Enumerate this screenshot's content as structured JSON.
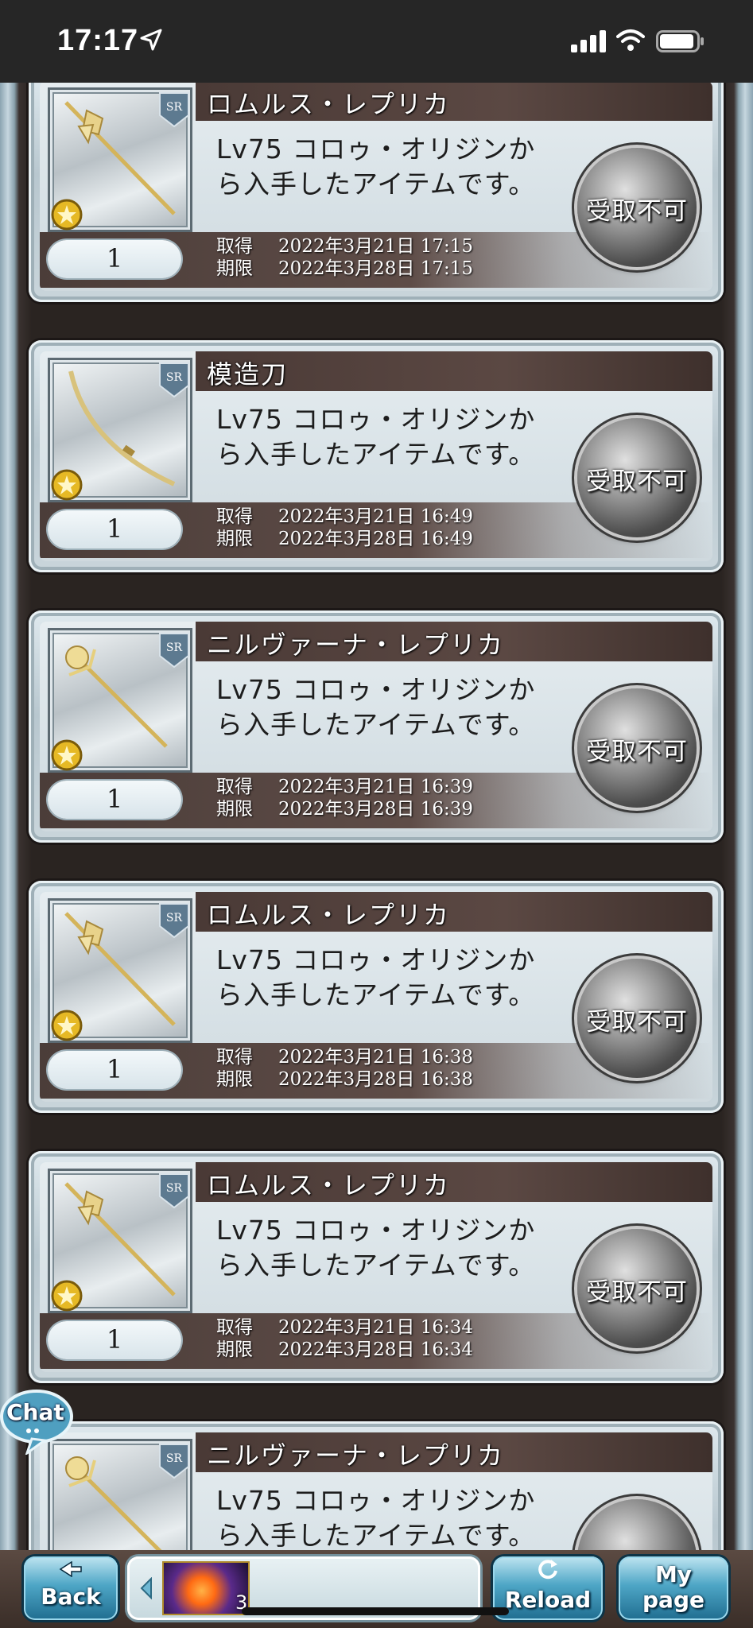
{
  "status_bar": {
    "time": "17:17"
  },
  "items": [
    {
      "name": "ロムルス・レプリカ",
      "rarity": "SR",
      "description": "Lv75 コロゥ・オリジンから入手したアイテムです。",
      "desc_line1": "Lv75 コロゥ・オリジンか",
      "desc_line2": "ら入手したアイテムです。",
      "quantity": "1",
      "acquired_label": "取得",
      "acquired": "2022年3月21日 17:15",
      "expiry_label": "期限",
      "expiry": "2022年3月28日 17:15",
      "button": "受取不可",
      "weapon_icon": "spear-icon"
    },
    {
      "name": "模造刀",
      "rarity": "SR",
      "description": "Lv75 コロゥ・オリジンから入手したアイテムです。",
      "desc_line1": "Lv75 コロゥ・オリジンか",
      "desc_line2": "ら入手したアイテムです。",
      "quantity": "1",
      "acquired_label": "取得",
      "acquired": "2022年3月21日 16:49",
      "expiry_label": "期限",
      "expiry": "2022年3月28日 16:49",
      "button": "受取不可",
      "weapon_icon": "katana-icon"
    },
    {
      "name": "ニルヴァーナ・レプリカ",
      "rarity": "SR",
      "description": "Lv75 コロゥ・オリジンから入手したアイテムです。",
      "desc_line1": "Lv75 コロゥ・オリジンか",
      "desc_line2": "ら入手したアイテムです。",
      "quantity": "1",
      "acquired_label": "取得",
      "acquired": "2022年3月21日 16:39",
      "expiry_label": "期限",
      "expiry": "2022年3月28日 16:39",
      "button": "受取不可",
      "weapon_icon": "staff-icon"
    },
    {
      "name": "ロムルス・レプリカ",
      "rarity": "SR",
      "description": "Lv75 コロゥ・オリジンから入手したアイテムです。",
      "desc_line1": "Lv75 コロゥ・オリジンか",
      "desc_line2": "ら入手したアイテムです。",
      "quantity": "1",
      "acquired_label": "取得",
      "acquired": "2022年3月21日 16:38",
      "expiry_label": "期限",
      "expiry": "2022年3月28日 16:38",
      "button": "受取不可",
      "weapon_icon": "spear-icon"
    },
    {
      "name": "ロムルス・レプリカ",
      "rarity": "SR",
      "description": "Lv75 コロゥ・オリジンから入手したアイテムです。",
      "desc_line1": "Lv75 コロゥ・オリジンか",
      "desc_line2": "ら入手したアイテムです。",
      "quantity": "1",
      "acquired_label": "取得",
      "acquired": "2022年3月21日 16:34",
      "expiry_label": "期限",
      "expiry": "2022年3月28日 16:34",
      "button": "受取不可",
      "weapon_icon": "spear-icon"
    },
    {
      "name": "ニルヴァーナ・レプリカ",
      "rarity": "SR",
      "description": "Lv75 コロゥ・オリジンから入手したアイテムです。",
      "desc_line1": "Lv75 コロゥ・オリジンか",
      "desc_line2": "ら入手したアイテムです。",
      "quantity": "",
      "acquired_label": "",
      "acquired": "",
      "expiry_label": "",
      "expiry": "",
      "button": "",
      "weapon_icon": "staff-icon"
    }
  ],
  "chat_button": "Chat",
  "nav": {
    "back": "Back",
    "reload": "Reload",
    "mypage_line1": "My",
    "mypage_line2": "page",
    "quest_count": "3"
  }
}
